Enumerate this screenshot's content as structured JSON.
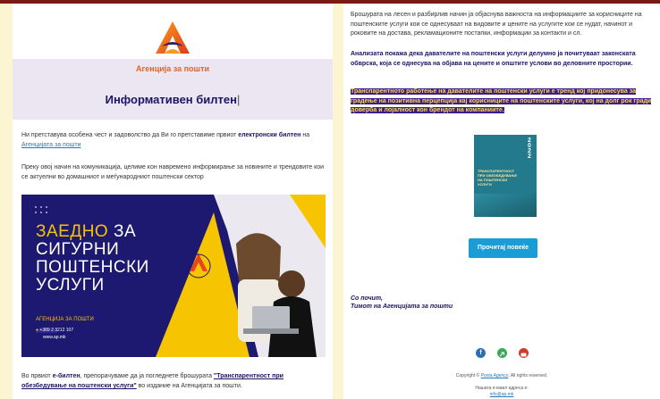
{
  "header": {
    "agency": "Агенција за пошти",
    "title": "Информативен билтен"
  },
  "intro": {
    "p1_before": "Ни претставува особена чест и задоволство да Ви го претставиме првиот ",
    "p1_bold": "електронски билтен",
    "p1_mid": " на ",
    "p1_link": "Агенцијата за пошти",
    "p2": "Преку овој начин на комуникација, целиме кон навремено информирање за новините и трендовите кои се актуелни во домашниот и меѓународниот поштенски сектор"
  },
  "banner": {
    "line1a": "ЗАЕДНО",
    "line1b": " ЗА",
    "line2": "СИГУРНИ",
    "line3": "ПОШТЕНСКИ",
    "line4": "УСЛУГИ",
    "agency": "АГЕНЦИЈА ЗА ПОШТИ",
    "phone": "+389 2 3212 107",
    "web": "www.ap.mk"
  },
  "outro": {
    "before": "Во првиот ",
    "bold": "е-билтен",
    "mid": ", препорачуваме да ја погледнете брошурата ",
    "link": "\"Транспарентност при обезбедување на поштенски услуги\"",
    "after": " во издание на Агенцијата за пошти."
  },
  "right": {
    "p1": "Брошурата на лесен и разбирлив начин ја објаснува важноста на информациите за корисниците на поштенските услуги кои се однесуваат на видовите и цените на услугите кои се нудат, начинот и роковите на достава, рекламационите постапки, информации за контакти и сл.",
    "p2": "Анализата покажа дека давателите на поштенски услуги делумно ја почитуваат законската обврска, која се однесува на објава на цените и општите услови во деловните простории.",
    "p3": "Транспарентното работење на давателите на поштенски услуги е тренд кој придонесува за градење на позитивна перцепција кај корисниците на поштенските услуги, кој на долг рок гради доверба и лојалност кон брендот на компаниите.",
    "cover_year": "2022",
    "cover_title": "ТРАНСПАРЕНТНОСТ ПРИ ОБЕЗБЕДУВАЊЕ НА ПОШТЕНСКИ УСЛУГИ",
    "button": "Прочитај повеќе",
    "sign1": "Со почит,",
    "sign2": "Тимот на Агенцијата за пошти",
    "copyright_pre": "Copyright © ",
    "copyright_link": "Posta Agency",
    "copyright_post": ", All rights reserved.",
    "email_label": "Нашата е-маил адреса е:",
    "email": "info@ap.mk"
  },
  "colors": {
    "brand_navy": "#1b1464",
    "brand_orange": "#e8631f",
    "highlight_bg": "#3a1f8a",
    "highlight_text": "#ffd84a",
    "button": "#1a9cd6"
  },
  "icons": [
    "facebook-icon",
    "website-icon",
    "youtube-icon"
  ]
}
